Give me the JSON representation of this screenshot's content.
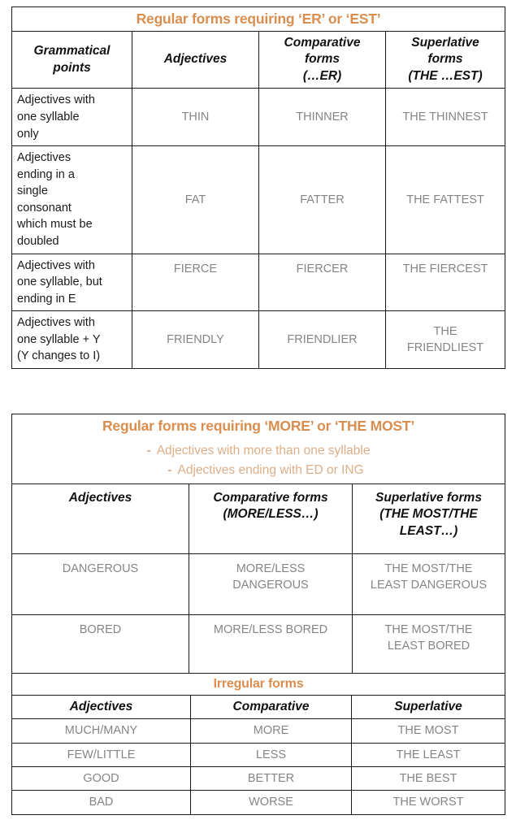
{
  "sections": [
    {
      "id": "er-est",
      "banner": "Regular forms requiring ‘ER’ or ‘EST’",
      "headers": [
        "Grammatical points",
        "Adjectives",
        "Comparative forms (…ER)",
        "Superlative forms (THE …EST)"
      ],
      "headers_lines": [
        [
          "Grammatical",
          "points"
        ],
        [
          "Adjectives"
        ],
        [
          "Comparative",
          "forms",
          "(…ER)"
        ],
        [
          "Superlative",
          "forms",
          "(THE …EST)"
        ]
      ],
      "rows": [
        {
          "point_lines": [
            "Adjectives with",
            "one syllable",
            "only"
          ],
          "adjective": "THIN",
          "comparative": "THINNER",
          "superlative": "THE THINNEST"
        },
        {
          "point_lines": [
            "Adjectives",
            "ending in a",
            "single",
            "consonant",
            "which must be",
            "doubled"
          ],
          "adjective": "FAT",
          "comparative": "FATTER",
          "superlative": "THE FATTEST"
        },
        {
          "point_lines": [
            "Adjectives with",
            "one syllable, but",
            "ending in E"
          ],
          "adjective": "FIERCE",
          "comparative": "FIERCER",
          "superlative": "THE FIERCEST"
        },
        {
          "point_lines": [
            "Adjectives with",
            "one syllable + Y",
            "(Y changes to I)"
          ],
          "adjective": "FRIENDLY",
          "comparative": "FRIENDLIER",
          "superlative_lines": [
            "THE",
            "FRIENDLIEST"
          ]
        }
      ]
    },
    {
      "id": "more-most",
      "banner": "Regular forms requiring ‘MORE’ or ‘THE MOST’",
      "bullets": [
        "Adjectives with more than one syllable",
        "Adjectives ending with ED or ING"
      ],
      "bullet_marker": "-",
      "headers": [
        "Adjectives",
        "Comparative forms (MORE/LESS…)",
        "Superlative forms (THE MOST/THE LEAST…)"
      ],
      "headers_lines": [
        [
          "Adjectives"
        ],
        [
          "Comparative forms",
          "(MORE/LESS…)"
        ],
        [
          "Superlative forms",
          "(THE MOST/THE",
          "LEAST…)"
        ]
      ],
      "rows": [
        {
          "adjective": "DANGEROUS",
          "comparative_lines": [
            "MORE/LESS",
            "DANGEROUS"
          ],
          "superlative_lines": [
            "THE MOST/THE",
            "LEAST DANGEROUS"
          ]
        },
        {
          "adjective": "BORED",
          "comparative_lines": [
            "MORE/LESS BORED"
          ],
          "superlative_lines": [
            "THE MOST/THE",
            "LEAST BORED"
          ]
        }
      ]
    },
    {
      "id": "irregular",
      "banner": "Irregular forms",
      "headers": [
        "Adjectives",
        "Comparative",
        "Superlative"
      ],
      "rows": [
        {
          "adjective": "MUCH/MANY",
          "comparative": "MORE",
          "superlative": "THE MOST"
        },
        {
          "adjective": "FEW/LITTLE",
          "comparative": "LESS",
          "superlative": "THE LEAST"
        },
        {
          "adjective": "GOOD",
          "comparative": "BETTER",
          "superlative": "THE BEST"
        },
        {
          "adjective": "BAD",
          "comparative": "WORSE",
          "superlative": "THE WORST"
        }
      ]
    }
  ],
  "colors": {
    "banner": "#D98E4F",
    "bullet": "#DDAE87",
    "value_text": "#858585",
    "header_text": "#111111",
    "border": "#1a1a1a",
    "background": "#ffffff"
  }
}
